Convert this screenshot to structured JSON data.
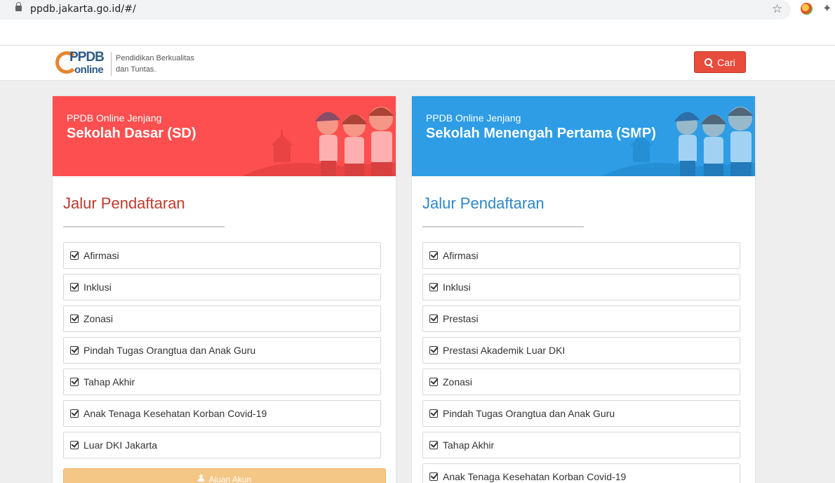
{
  "browser": {
    "url": "ppdb.jakarta.go.id/#/",
    "icons": [
      "lock-icon",
      "star-icon",
      "extension-icon",
      "puzzle-icon"
    ]
  },
  "header": {
    "logo_top": "PPDB",
    "logo_bottom": "online",
    "tagline_line1": "Pendidikan Berkualitas",
    "tagline_line2": "dan Tuntas.",
    "search_label": "Cari"
  },
  "sd": {
    "pre": "PPDB Online Jenjang",
    "level": "Sekolah Dasar (SD)",
    "section_title": "Jalur Pendaftaran",
    "options": [
      "Afirmasi",
      "Inklusi",
      "Zonasi",
      "Pindah Tugas Orangtua dan Anak Guru",
      "Tahap Akhir",
      "Anak Tenaga Kesehatan Korban Covid-19",
      "Luar DKI Jakarta"
    ],
    "account_button": "Ajuan Akun",
    "color": "#fd4f4f"
  },
  "smp": {
    "pre": "PPDB Online Jenjang",
    "level": "Sekolah Menengah Pertama (SMP)",
    "section_title": "Jalur Pendaftaran",
    "options": [
      "Afirmasi",
      "Inklusi",
      "Prestasi",
      "Prestasi Akademik Luar DKI",
      "Zonasi",
      "Pindah Tugas Orangtua dan Anak Guru",
      "Tahap Akhir",
      "Anak Tenaga Kesehatan Korban Covid-19"
    ],
    "color": "#2e9de6"
  }
}
